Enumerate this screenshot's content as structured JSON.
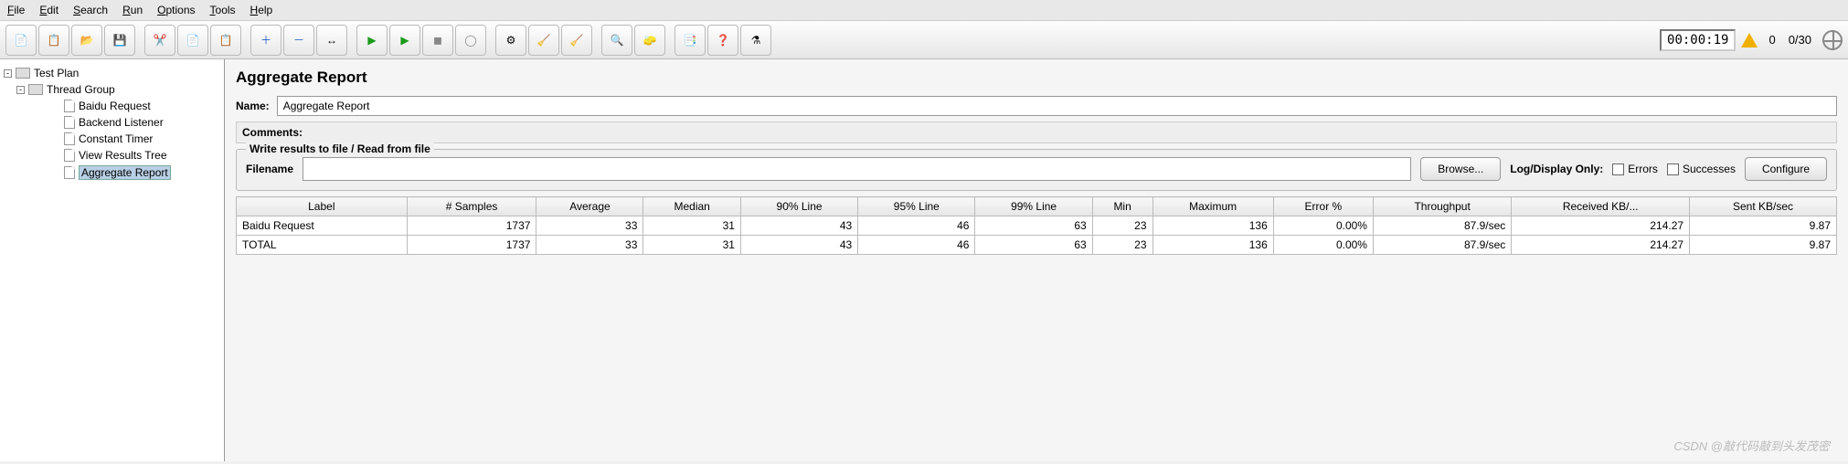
{
  "menu": {
    "file": "File",
    "edit": "Edit",
    "search": "Search",
    "run": "Run",
    "options": "Options",
    "tools": "Tools",
    "help": "Help"
  },
  "status": {
    "timer": "00:00:19",
    "warn_count": "0",
    "threads": "0/30"
  },
  "tree": {
    "root": "Test Plan",
    "group": "Thread Group",
    "items": [
      "Baidu Request",
      "Backend Listener",
      "Constant Timer",
      "View Results Tree",
      "Aggregate Report"
    ],
    "selected_index": 4
  },
  "panel": {
    "title": "Aggregate Report",
    "name_label": "Name:",
    "name_value": "Aggregate Report",
    "comments_label": "Comments:",
    "file_legend": "Write results to file / Read from file",
    "filename_label": "Filename",
    "browse": "Browse...",
    "logdisplay": "Log/Display Only:",
    "errors": "Errors",
    "successes": "Successes",
    "configure": "Configure"
  },
  "chart_data": {
    "type": "table",
    "columns": [
      "Label",
      "# Samples",
      "Average",
      "Median",
      "90% Line",
      "95% Line",
      "99% Line",
      "Min",
      "Maximum",
      "Error %",
      "Throughput",
      "Received KB/...",
      "Sent KB/sec"
    ],
    "rows": [
      {
        "label": "Baidu Request",
        "samples": 1737,
        "avg": 33,
        "median": 31,
        "p90": 43,
        "p95": 46,
        "p99": 63,
        "min": 23,
        "max": 136,
        "error": "0.00%",
        "throughput": "87.9/sec",
        "recv": "214.27",
        "sent": "9.87"
      },
      {
        "label": "TOTAL",
        "samples": 1737,
        "avg": 33,
        "median": 31,
        "p90": 43,
        "p95": 46,
        "p99": 63,
        "min": 23,
        "max": 136,
        "error": "0.00%",
        "throughput": "87.9/sec",
        "recv": "214.27",
        "sent": "9.87"
      }
    ]
  },
  "watermark": "CSDN @敲代码敲到头发茂密"
}
